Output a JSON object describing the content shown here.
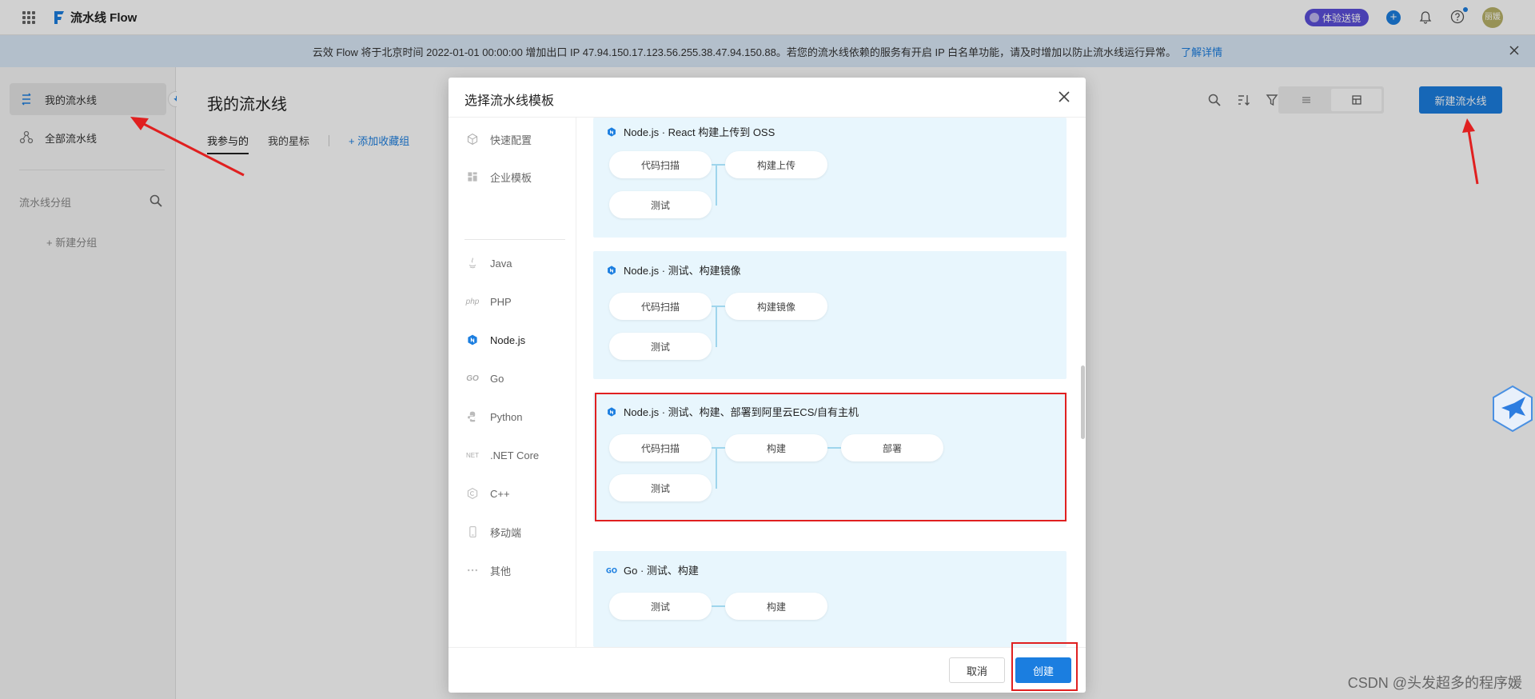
{
  "topbar": {
    "brand_name": "流水线 Flow",
    "trial_label": "体验送镜",
    "avatar_text": "丽媛"
  },
  "notice": {
    "text": "云效 Flow 将于北京时间 2022-01-01 00:00:00 增加出口 IP 47.94.150.17.123.56.255.38.47.94.150.88。若您的流水线依赖的服务有开启 IP 白名单功能，请及时增加以防止流水线运行异常。",
    "link": "了解详情"
  },
  "sidebar": {
    "items": [
      {
        "label": "我的流水线",
        "icon": "pipeline-icon"
      },
      {
        "label": "全部流水线",
        "icon": "all-pipelines-icon"
      }
    ],
    "group_title": "流水线分组",
    "new_group": "+ 新建分组"
  },
  "main": {
    "title": "我的流水线",
    "tabs": [
      "我参与的",
      "我的星标"
    ],
    "add_group": "+ 添加收藏组",
    "new_pipeline_label": "新建流水线"
  },
  "modal": {
    "title": "选择流水线模板",
    "nav": [
      {
        "label": "快速配置",
        "icon": "cube-icon"
      },
      {
        "label": "企业模板",
        "icon": "grid-icon"
      },
      {
        "label": "Java",
        "icon": "java-icon"
      },
      {
        "label": "PHP",
        "icon": "php-icon"
      },
      {
        "label": "Node.js",
        "icon": "nodejs-icon"
      },
      {
        "label": "Go",
        "icon": "go-icon"
      },
      {
        "label": "Python",
        "icon": "python-icon"
      },
      {
        "label": ".NET Core",
        "icon": "dotnet-icon"
      },
      {
        "label": "C++",
        "icon": "cpp-icon"
      },
      {
        "label": "移动端",
        "icon": "mobile-icon"
      },
      {
        "label": "其他",
        "icon": "more-icon"
      }
    ],
    "nav_icon_text": {
      "php": "php",
      "go": "GO",
      "dotnet": "NET"
    },
    "templates": [
      {
        "title": "Node.js · React 构建上传到 OSS",
        "steps": [
          "代码扫描",
          "构建上传",
          "测试"
        ]
      },
      {
        "title": "Node.js · 测试、构建镜像",
        "steps": [
          "代码扫描",
          "构建镜像",
          "测试"
        ]
      },
      {
        "title": "Node.js · 测试、构建、部署到阿里云ECS/自有主机",
        "steps": [
          "代码扫描",
          "构建",
          "部署",
          "测试"
        ]
      },
      {
        "title": "Go · 测试、构建",
        "steps": [
          "测试",
          "构建"
        ]
      }
    ],
    "cancel_label": "取消",
    "create_label": "创建"
  },
  "watermark": "CSDN @头发超多的程序媛",
  "colors": {
    "primary": "#1b7ee0",
    "annotation_red": "#e02020",
    "card_bg": "#e8f6fd"
  }
}
